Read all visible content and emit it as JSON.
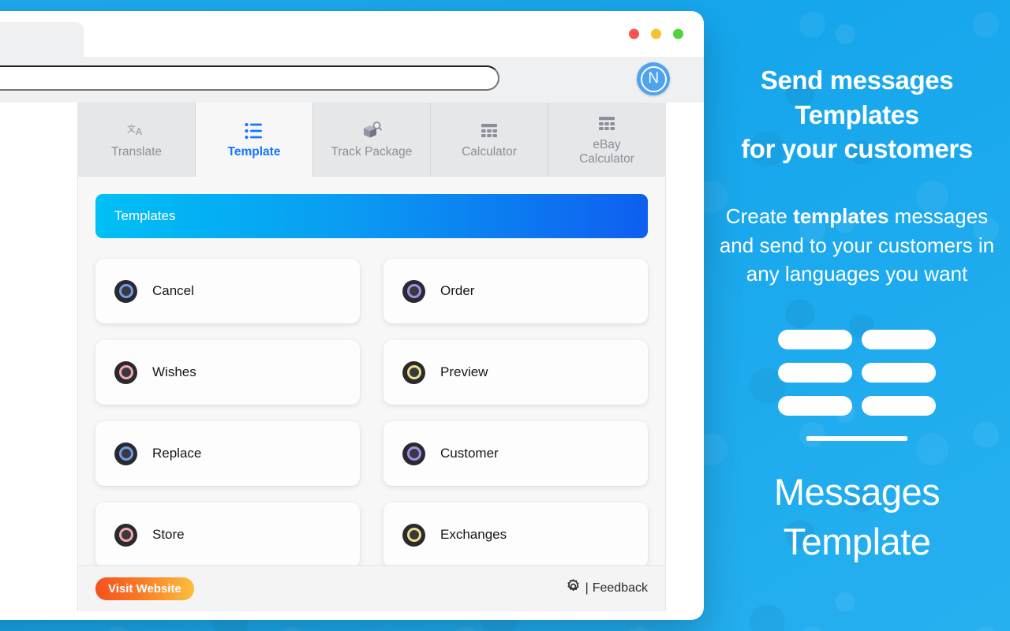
{
  "browser": {
    "traffic_lights": [
      {
        "name": "close",
        "color": "#f8544b"
      },
      {
        "name": "minimize",
        "color": "#f6c233"
      },
      {
        "name": "maximize",
        "color": "#4fd33c"
      }
    ],
    "url_value": "",
    "url_placeholder": "",
    "extension_badge_letter": "N"
  },
  "popup": {
    "tabs": [
      {
        "label": "Translate",
        "icon": "translate-icon",
        "active": false
      },
      {
        "label": "Template",
        "icon": "list-icon",
        "active": true
      },
      {
        "label": "Track Package",
        "icon": "package-search-icon",
        "active": false
      },
      {
        "label": "Calculator",
        "icon": "calculator-icon",
        "active": false
      },
      {
        "label": "eBay\nCalculator",
        "icon": "calculator-icon",
        "active": false
      }
    ],
    "section_header": "Templates",
    "templates": [
      {
        "label": "Cancel",
        "ring": "#6f9bee"
      },
      {
        "label": "Order",
        "ring": "#a58cec"
      },
      {
        "label": "Wishes",
        "ring": "#f2a8ad"
      },
      {
        "label": "Preview",
        "ring": "#ece08a"
      },
      {
        "label": "Replace",
        "ring": "#6f9bee"
      },
      {
        "label": "Customer",
        "ring": "#a58cec"
      },
      {
        "label": "Store",
        "ring": "#f2a8ad"
      },
      {
        "label": "Exchanges",
        "ring": "#ece08a"
      }
    ],
    "footer": {
      "visit_label": "Visit Website",
      "feedback_separator": "|",
      "feedback_label": "Feedback",
      "gear_icon": "gear-icon"
    }
  },
  "promo": {
    "title_lines": [
      "Send messages",
      "Templates",
      "for your customers"
    ],
    "subtitle_pre": "Create ",
    "subtitle_bold": "templates",
    "subtitle_post": " messages and send to your customers in any languages you want",
    "pill_count": 6,
    "footer_lines": [
      "Messages",
      "Template"
    ],
    "accent_color": "#1fa9ef"
  }
}
